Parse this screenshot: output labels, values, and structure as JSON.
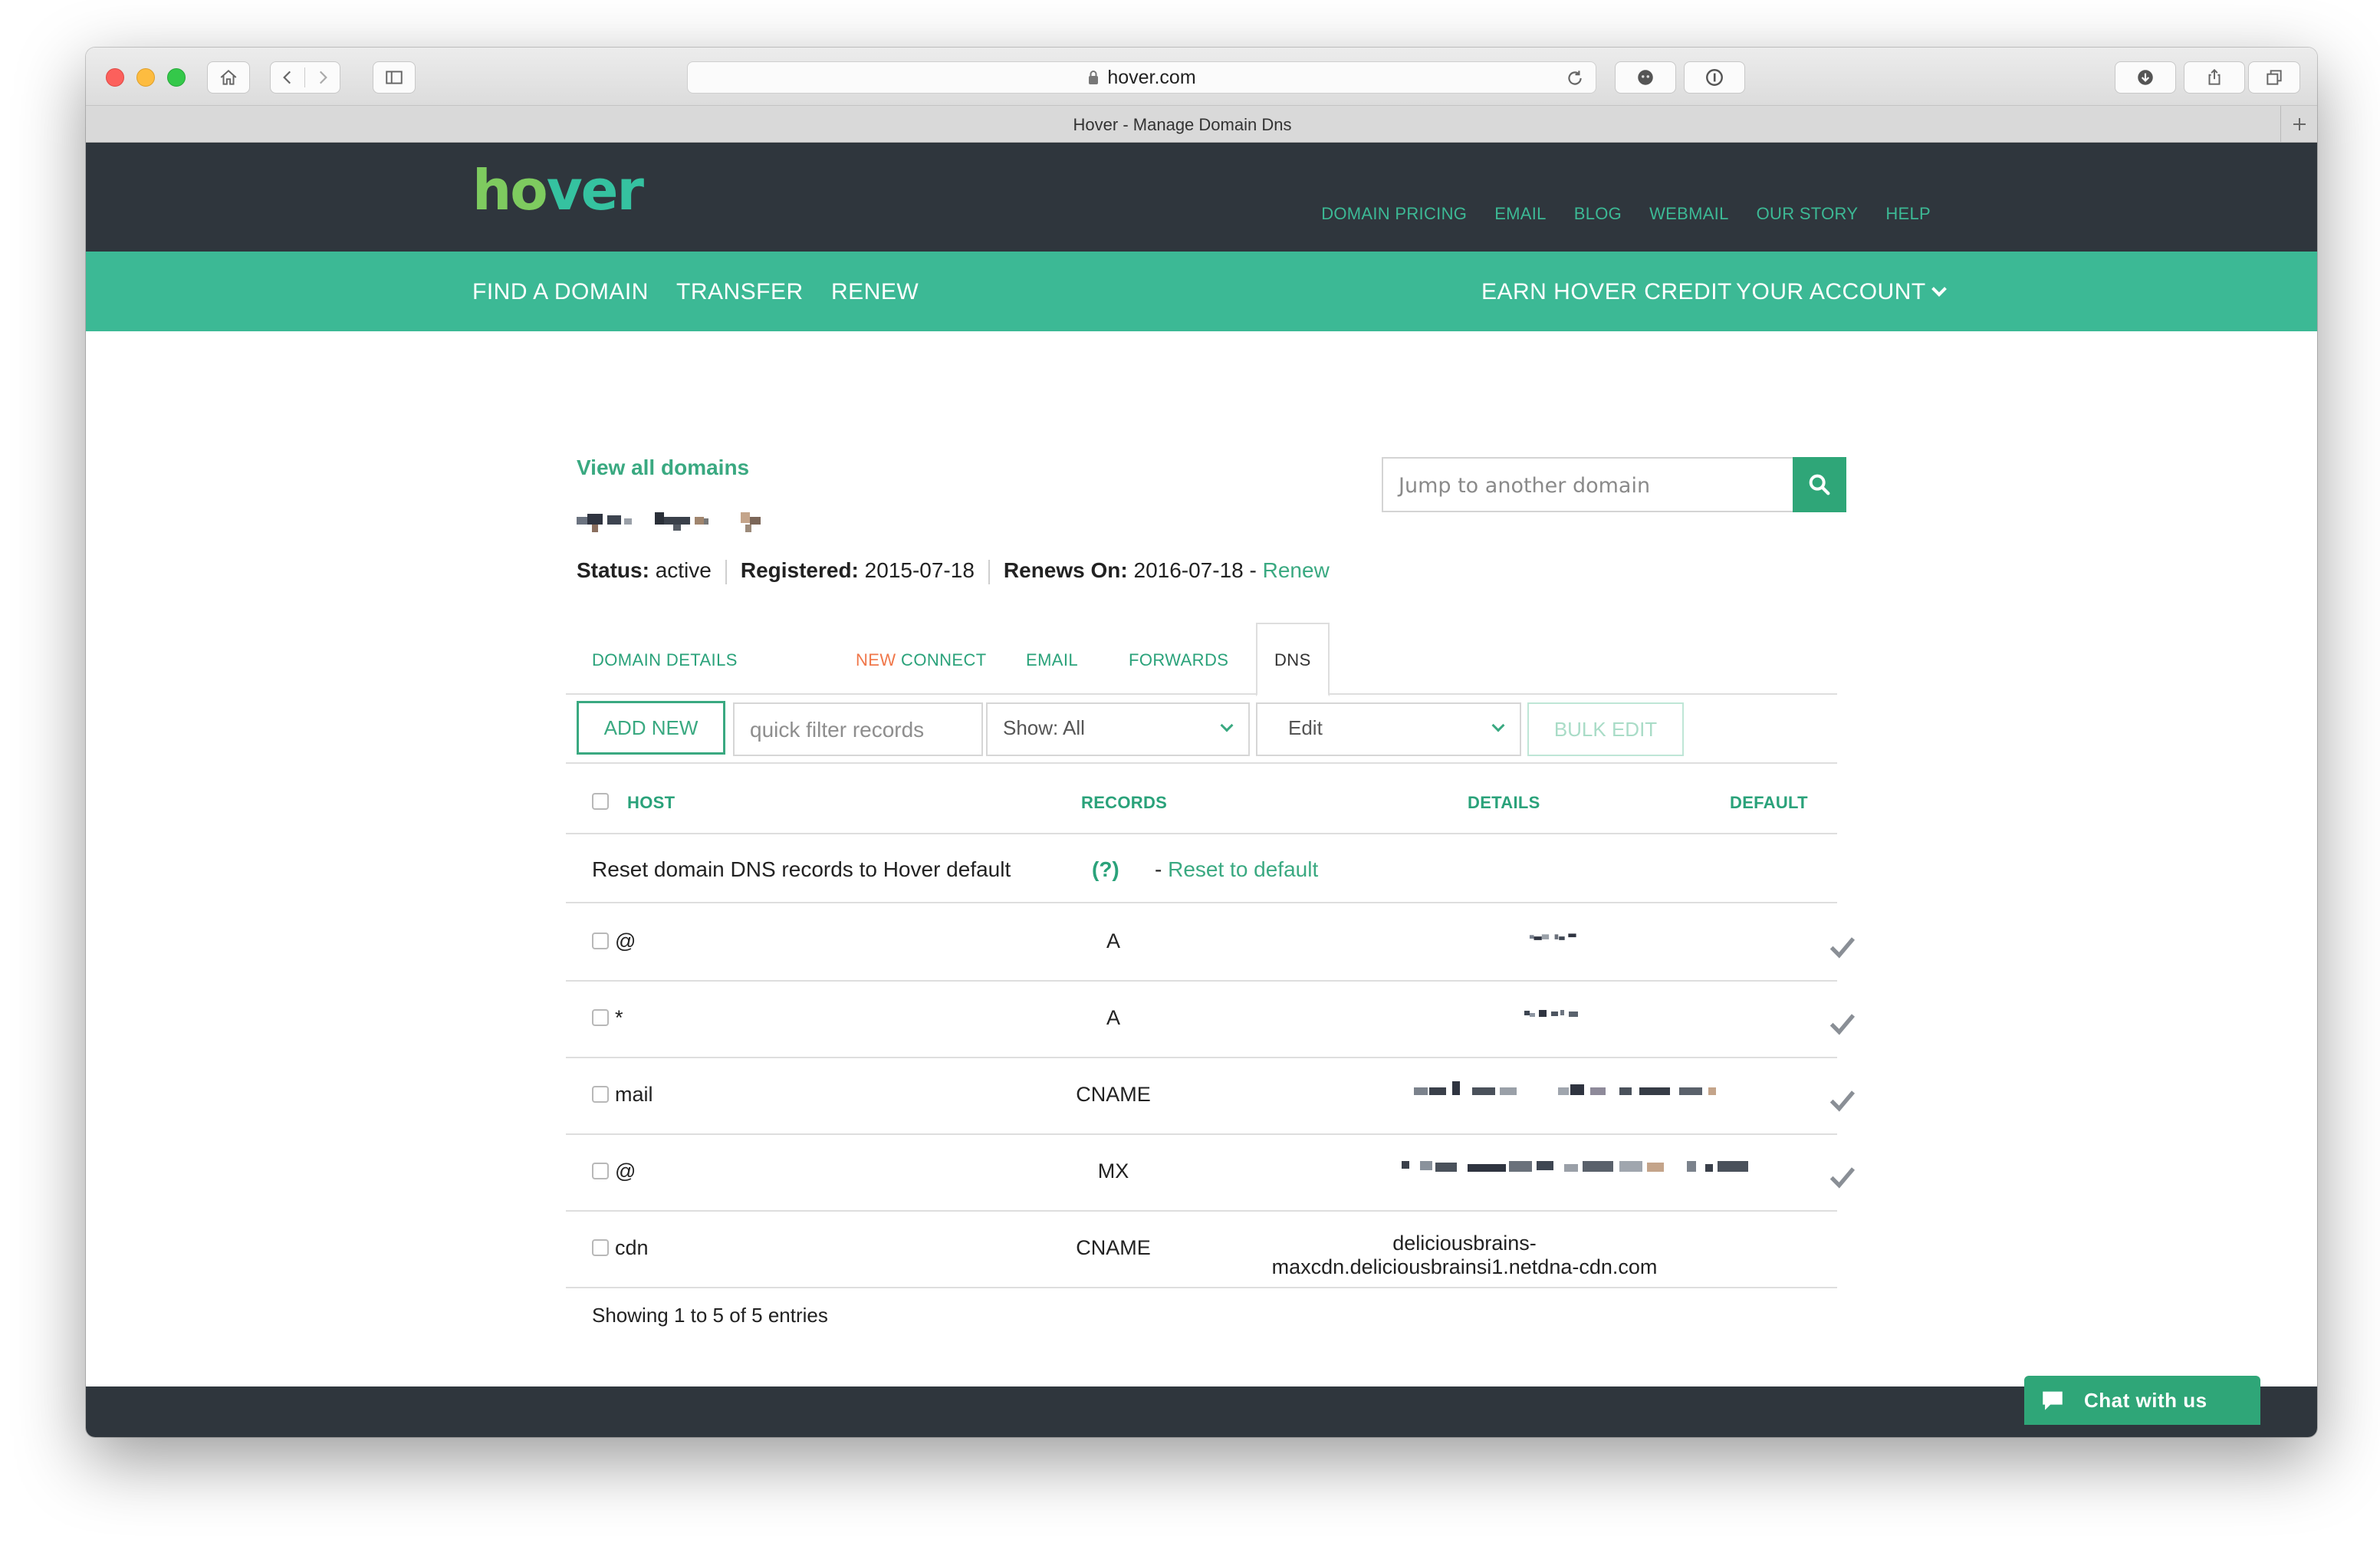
{
  "browser": {
    "url": "hover.com",
    "tab_title": "Hover - Manage Domain Dns"
  },
  "site": {
    "logo": {
      "part1": "ho",
      "part2": "ver"
    },
    "top_nav": [
      "DOMAIN PRICING",
      "EMAIL",
      "BLOG",
      "WEBMAIL",
      "OUR STORY",
      "HELP"
    ],
    "main_nav": {
      "find": "FIND A DOMAIN",
      "transfer": "TRANSFER",
      "renew": "RENEW",
      "earn": "EARN HOVER CREDIT",
      "account": "YOUR ACCOUNT"
    },
    "colors": {
      "brand_green": "#3cb995",
      "dark": "#2f363d",
      "new_orange": "#f0774a"
    }
  },
  "domain": {
    "view_all": "View all domains",
    "search_placeholder": "Jump to another domain",
    "status_label": "Status:",
    "status_value": "active",
    "registered_label": "Registered:",
    "registered_value": "2015-07-18",
    "renews_label": "Renews On:",
    "renews_value": "2016-07-18",
    "renews_sep": " - ",
    "renew_link": "Renew"
  },
  "tabs": {
    "domain_details": "DOMAIN DETAILS",
    "new_badge": "NEW",
    "connect": "CONNECT",
    "email": "EMAIL",
    "forwards": "FORWARDS",
    "dns": "DNS"
  },
  "controls": {
    "add_new": "ADD NEW",
    "filter_placeholder": "quick filter records",
    "show_value": "Show: All",
    "edit_value": "Edit",
    "bulk_edit": "BULK EDIT"
  },
  "table": {
    "headers": {
      "host": "HOST",
      "records": "RECORDS",
      "details": "DETAILS",
      "default": "DEFAULT"
    },
    "reset": {
      "text": "Reset domain DNS records to Hover default",
      "help": "(?)",
      "prefix": "- ",
      "link": "Reset to default"
    },
    "rows": [
      {
        "host": "@",
        "record": "A",
        "details": "",
        "default": true
      },
      {
        "host": "*",
        "record": "A",
        "details": "",
        "default": true
      },
      {
        "host": "mail",
        "record": "CNAME",
        "details": "",
        "default": true
      },
      {
        "host": "@",
        "record": "MX",
        "details": "",
        "default": true
      },
      {
        "host": "cdn",
        "record": "CNAME",
        "details_line1": "deliciousbrains-",
        "details_line2": "maxcdn.deliciousbrainsi1.netdna-cdn.com",
        "default": false
      }
    ],
    "showing": "Showing 1 to 5 of 5 entries"
  },
  "chat": {
    "label": "Chat with us"
  }
}
